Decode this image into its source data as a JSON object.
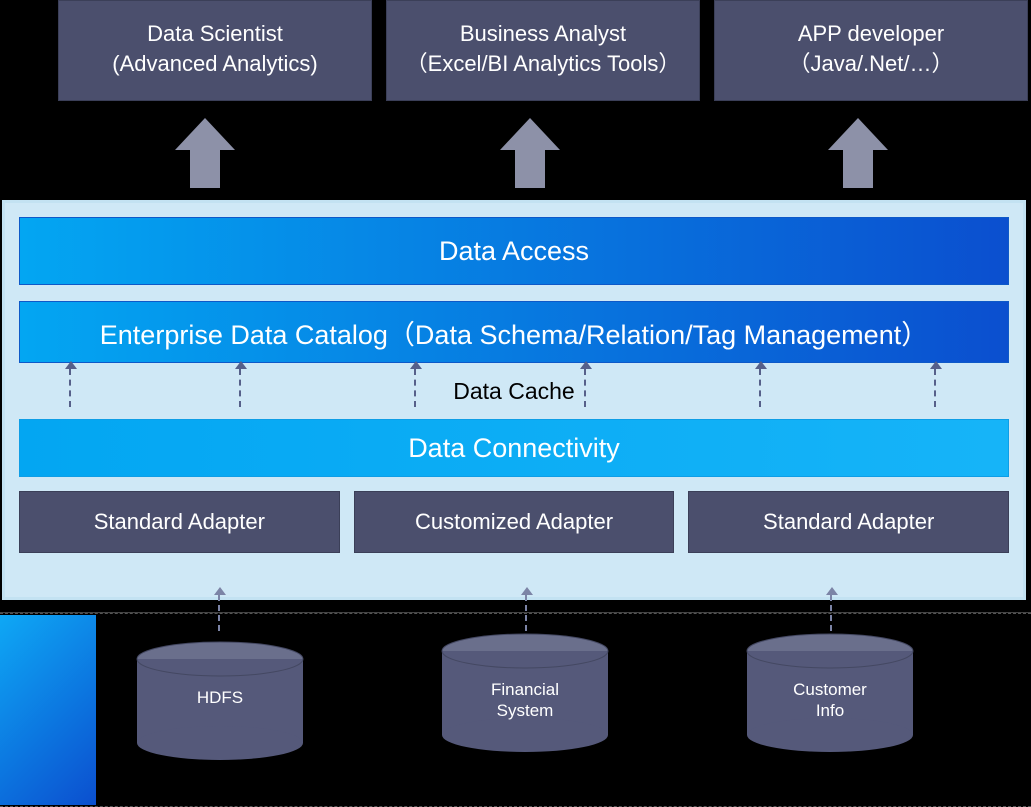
{
  "consumers": [
    {
      "title": "Data Scientist",
      "sub": "(Advanced Analytics)"
    },
    {
      "title": "Business Analyst",
      "sub": "（Excel/BI Analytics Tools）"
    },
    {
      "title": "APP developer",
      "sub": "（Java/.Net/…）"
    }
  ],
  "platform": {
    "data_access": "Data Access",
    "catalog": "Enterprise Data Catalog（Data Schema/Relation/Tag Management）",
    "cache": "Data Cache",
    "connectivity": "Data Connectivity",
    "adapters": [
      "Standard Adapter",
      "Customized Adapter",
      "Standard Adapter"
    ]
  },
  "sources": [
    {
      "label_line1": "HDFS",
      "label_line2": ""
    },
    {
      "label_line1": "Financial",
      "label_line2": "System"
    },
    {
      "label_line1": "Customer",
      "label_line2": "Info"
    }
  ],
  "colors": {
    "box": "#4b4f6d",
    "platform_bg": "#cfe8f6",
    "gradient_start": "#03a6f2",
    "gradient_end": "#0b4fcf"
  }
}
